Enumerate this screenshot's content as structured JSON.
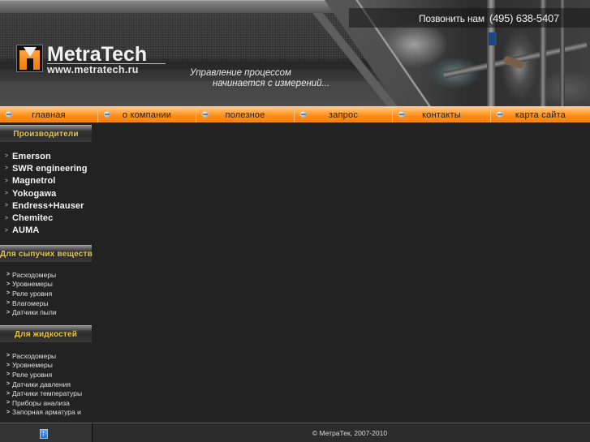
{
  "header": {
    "logo": {
      "name": "MetraTech",
      "url": "www.metratech.ru"
    },
    "slogan": {
      "line1": "Управление процессом",
      "line2": "начинается с измерений..."
    },
    "phone": {
      "label": "Позвонить нам",
      "number": "(495) 638-5407"
    }
  },
  "nav": {
    "items": [
      {
        "label": "главная"
      },
      {
        "label": "о компании"
      },
      {
        "label": "полезное"
      },
      {
        "label": "запрос"
      },
      {
        "label": "контакты"
      },
      {
        "label": "карта сайта"
      }
    ]
  },
  "sidebar": {
    "makers": {
      "title": "Производители",
      "items": [
        {
          "label": "Emerson"
        },
        {
          "label": "SWR engineering"
        },
        {
          "label": "Magnetrol"
        },
        {
          "label": "Yokogawa"
        },
        {
          "label": "Endress+Hauser"
        },
        {
          "label": "Chemitec"
        },
        {
          "label": "AUMA"
        }
      ]
    },
    "bulk": {
      "title": "Для сыпучих веществ",
      "items": [
        {
          "label": "Расходомеры"
        },
        {
          "label": "Уровнемеры"
        },
        {
          "label": "Реле уровня"
        },
        {
          "label": "Влагомеры"
        },
        {
          "label": "Датчики пыли"
        }
      ]
    },
    "liquid": {
      "title": "Для жидкостей",
      "items": [
        {
          "label": "Расходомеры"
        },
        {
          "label": "Уровнемеры"
        },
        {
          "label": "Реле уровня"
        },
        {
          "label": "Датчики давления"
        },
        {
          "label": "Датчики температуры"
        },
        {
          "label": "Приборы анализа"
        },
        {
          "label": "Запорная арматура и"
        }
      ]
    }
  },
  "footer": {
    "copyright": "© МетраТек, 2007-2010",
    "counter_icon": "counter-icon"
  },
  "colors": {
    "accent_orange": "#ff8a10",
    "sidebar_heading": "#e5c341",
    "background": "#222222"
  }
}
